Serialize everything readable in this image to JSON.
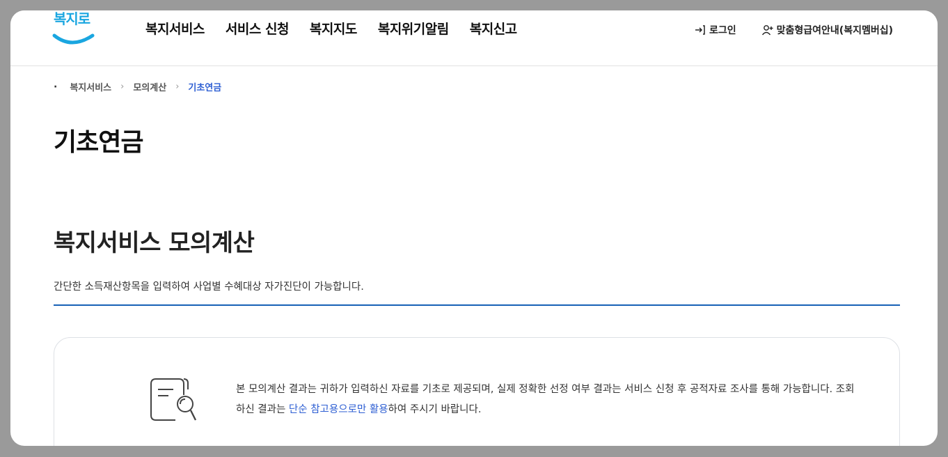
{
  "header": {
    "logo_text": "복지로",
    "nav": [
      "복지서비스",
      "서비스 신청",
      "복지지도",
      "복지위기알림",
      "복지신고"
    ],
    "login_label": "로그인",
    "membership_label": "맞춤형급여안내(복지멤버십)"
  },
  "breadcrumb": [
    "복지서비스",
    "모의계산",
    "기초연금"
  ],
  "page_title": "기초연금",
  "section": {
    "title": "복지서비스 모의계산",
    "description": "간단한 소득재산항목을 입력하여 사업별 수혜대상 자가진단이 가능합니다."
  },
  "notice": {
    "text_before": "본 모의계산 결과는 귀하가 입력하신 자료를 기초로 제공되며, 실제 정확한 선정 여부 결과는 서비스 신청 후 공적자료 조사를 통해 가능합니다. 조회하신 결과는 ",
    "text_highlight": "단순 참고용으로만 활용",
    "text_after": "하여 주시기 바랍니다."
  },
  "colors": {
    "accent": "#2e5fd3",
    "section_line": "#1761b6",
    "logo": "#1aa6e0"
  }
}
